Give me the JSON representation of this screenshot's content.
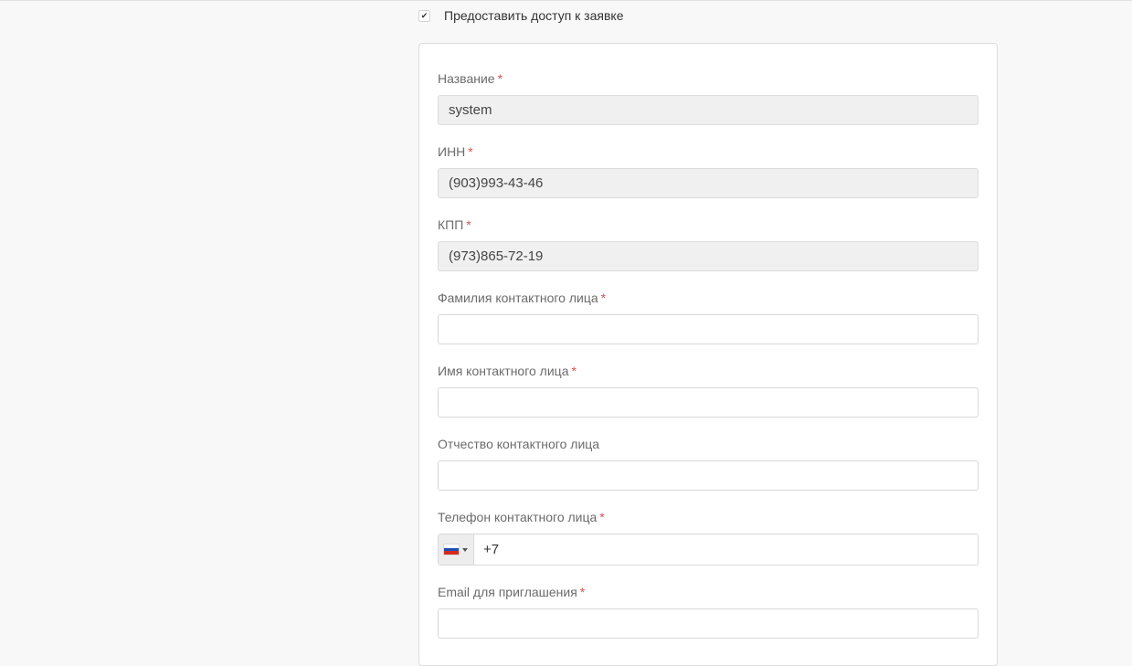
{
  "access": {
    "checked": true,
    "check_glyph": "✔",
    "label": "Предоставить доступ к заявке"
  },
  "required_mark": "*",
  "form": {
    "name": {
      "label": "Название",
      "value": "system",
      "required": true,
      "disabled": true
    },
    "inn": {
      "label": "ИНН",
      "value": "(903)993-43-46",
      "required": true,
      "disabled": true
    },
    "kpp": {
      "label": "КПП",
      "value": "(973)865-72-19",
      "required": true,
      "disabled": true
    },
    "last_name": {
      "label": "Фамилия контактного лица",
      "value": "",
      "required": true
    },
    "first_name": {
      "label": "Имя контактного лица",
      "value": "",
      "required": true
    },
    "middle_name": {
      "label": "Отчество контактного лица",
      "value": "",
      "required": false
    },
    "phone": {
      "label": "Телефон контактного лица",
      "value": "+7",
      "required": true,
      "country": "ru-flag-icon"
    },
    "email": {
      "label": "Email для приглашения",
      "value": "",
      "required": true
    }
  },
  "colors": {
    "required": "#d9534f",
    "disabled_bg": "#f0f0f0",
    "flag_white": "#ffffff",
    "flag_blue": "#1f4fb8",
    "flag_red": "#d52b1e"
  }
}
